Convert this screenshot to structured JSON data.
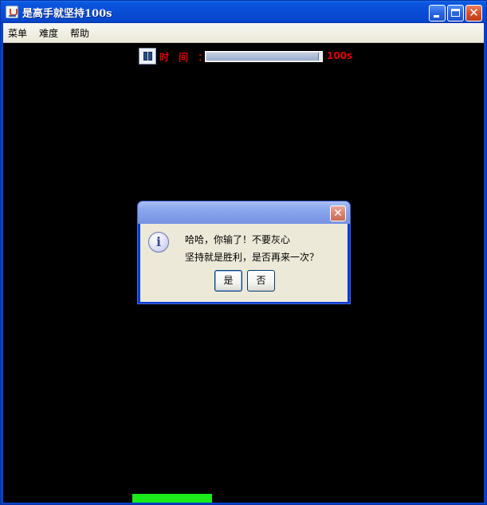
{
  "window": {
    "title": "是高手就坚持100s",
    "controls": {
      "minimize": "minimize-icon",
      "maximize": "maximize-icon",
      "close": "close-icon"
    }
  },
  "menubar": {
    "items": [
      {
        "label": "菜单"
      },
      {
        "label": "难度"
      },
      {
        "label": "帮助"
      }
    ]
  },
  "game": {
    "time_label": "时 间 ：",
    "time_value": "100s",
    "time_progress": 0.97,
    "label_color": "#e00000",
    "paddle_color": "#1bea1b",
    "background": "#000000"
  },
  "dialog": {
    "icon": "info-icon",
    "icon_glyph": "i",
    "message_line_1": "哈哈，你输了！不要灰心",
    "message_line_2": "坚持就是胜利，是否再来一次？",
    "yes_label": "是",
    "no_label": "否"
  }
}
